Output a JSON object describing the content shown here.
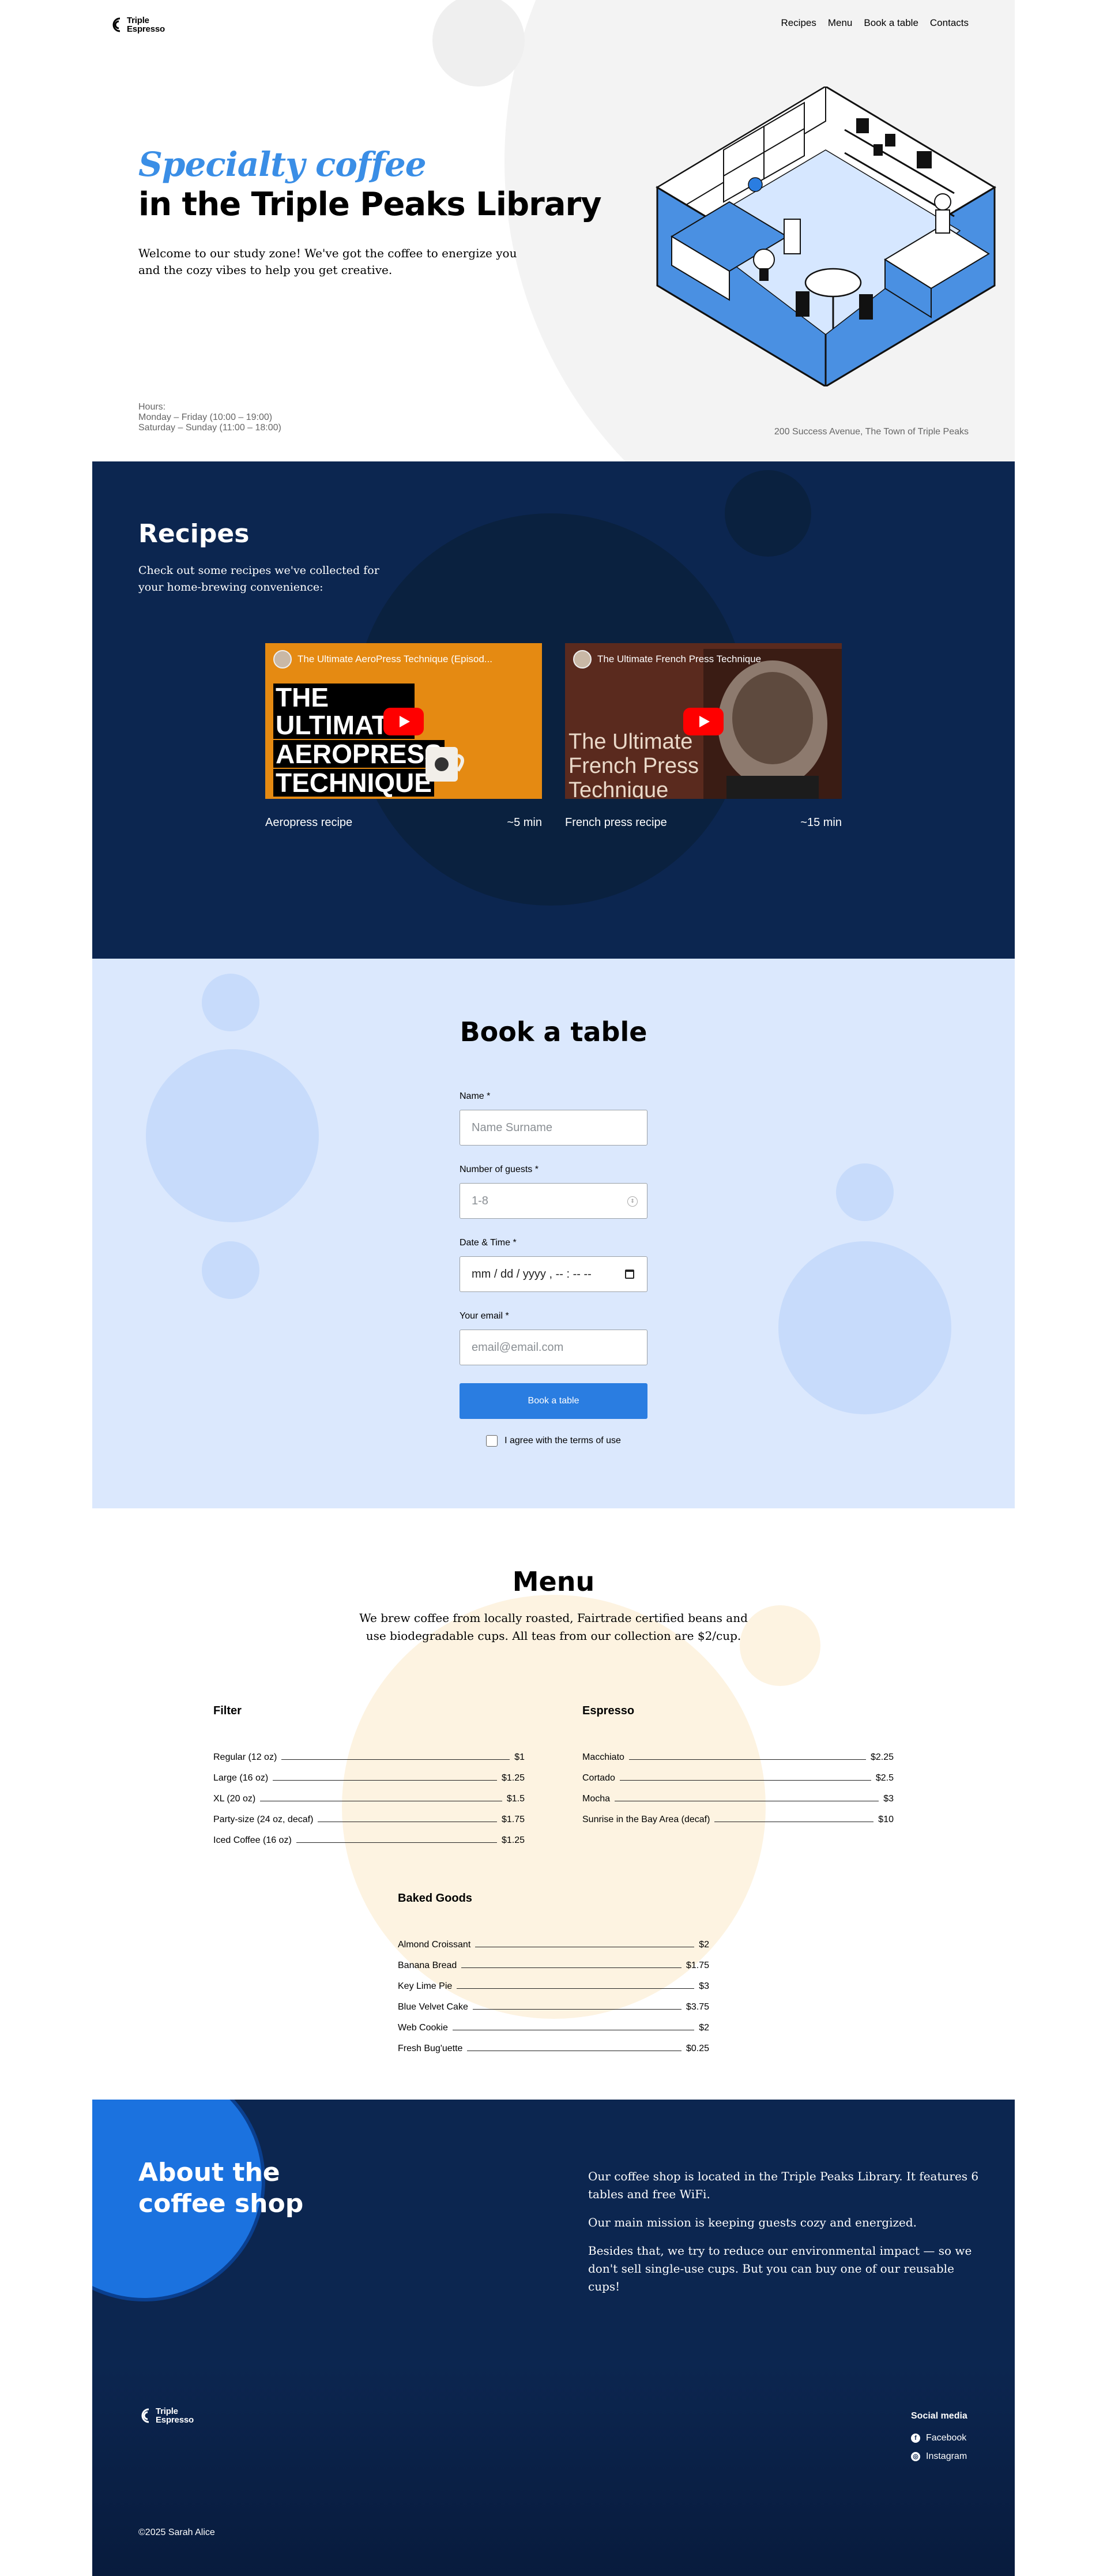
{
  "header": {
    "logo": [
      "Triple",
      "Espresso"
    ],
    "nav": [
      "Recipes",
      "Menu",
      "Book a table",
      "Contacts"
    ]
  },
  "hero": {
    "title_accent": "Specialty coffee",
    "title_rest": "in the Triple Peaks Library",
    "description": "Welcome to our study zone! We've got the coffee to energize you and the cozy vibes to help you get creative.",
    "hours": [
      "Hours:",
      "Monday – Friday (10:00 – 19:00)",
      "Saturday – Sunday (11:00 – 18:00)"
    ],
    "address": "200 Success Avenue, The Town of Triple Peaks"
  },
  "recipes": {
    "title": "Recipes",
    "description": "Check out some recipes we've collected for your home-brewing convenience:",
    "videos": [
      {
        "title": "The Ultimate AeroPress Technique (Episod...",
        "thumb_lines": [
          "THE ULTIMATE",
          "AEROPRESS",
          "TECHNIQUE"
        ],
        "label": "Aeropress recipe",
        "time": "~5 min"
      },
      {
        "title": "The Ultimate French Press Technique",
        "thumb_lines": [
          "The Ultimate",
          "French Press",
          "Technique"
        ],
        "label": "French press recipe",
        "time": "~15 min"
      }
    ]
  },
  "booking": {
    "title": "Book a table",
    "fields": [
      {
        "label": "Name *",
        "placeholder": "Name Surname"
      },
      {
        "label": "Number of guests *",
        "placeholder": "1-8"
      },
      {
        "label": "Date & Time *",
        "placeholder": "mm / dd / yyyy , -- : --  --"
      },
      {
        "label": "Your email *",
        "placeholder": "email@email.com"
      }
    ],
    "button": "Book a table",
    "terms": "I agree with the terms of use"
  },
  "menu": {
    "title": "Menu",
    "description": "We brew coffee from locally roasted, Fairtrade certified beans and use biodegradable cups. All teas from our collection are $2/cup.",
    "filter": {
      "title": "Filter",
      "items": [
        {
          "name": "Regular (12 oz)",
          "price": "$1"
        },
        {
          "name": "Large (16 oz)",
          "price": "$1.25"
        },
        {
          "name": "XL (20 oz)",
          "price": "$1.5"
        },
        {
          "name": "Party-size (24 oz, decaf)",
          "price": "$1.75"
        },
        {
          "name": "Iced Coffee (16 oz)",
          "price": "$1.25"
        }
      ]
    },
    "espresso": {
      "title": "Espresso",
      "items": [
        {
          "name": "Macchiato",
          "price": "$2.25"
        },
        {
          "name": "Cortado",
          "price": "$2.5"
        },
        {
          "name": "Mocha",
          "price": "$3"
        },
        {
          "name": "Sunrise in the Bay Area (decaf)",
          "price": "$10"
        }
      ]
    },
    "baked": {
      "title": "Baked Goods",
      "items": [
        {
          "name": "Almond Croissant",
          "price": "$2"
        },
        {
          "name": "Banana Bread",
          "price": "$1.75"
        },
        {
          "name": "Key Lime Pie",
          "price": "$3"
        },
        {
          "name": "Blue Velvet Cake",
          "price": "$3.75"
        },
        {
          "name": "Web Cookie",
          "price": "$2"
        },
        {
          "name": "Fresh Bug'uette",
          "price": "$0.25"
        }
      ]
    }
  },
  "about": {
    "title": "About the coffee shop",
    "paragraphs": [
      "Our coffee shop is located in the Triple Peaks Library. It features 6 tables and free WiFi.",
      "Our main mission is keeping guests cozy and energized.",
      "Besides that, we try to reduce our environmental impact — so we don't sell single-use cups. But you can buy one of our reusable cups!"
    ]
  },
  "footer": {
    "logo": [
      "Triple",
      "Espresso"
    ],
    "social_title": "Social media",
    "social": [
      {
        "label": "Facebook",
        "icon": "facebook-icon"
      },
      {
        "label": "Instagram",
        "icon": "instagram-icon"
      }
    ],
    "copyright": "©2025 Sarah Alice"
  },
  "colors": {
    "accent_blue": "#3a8ee6",
    "navy": "#0c2650",
    "button_blue": "#2a7de1",
    "booking_bg": "#dbe8fd",
    "menu_circle": "#fdf3e1"
  }
}
